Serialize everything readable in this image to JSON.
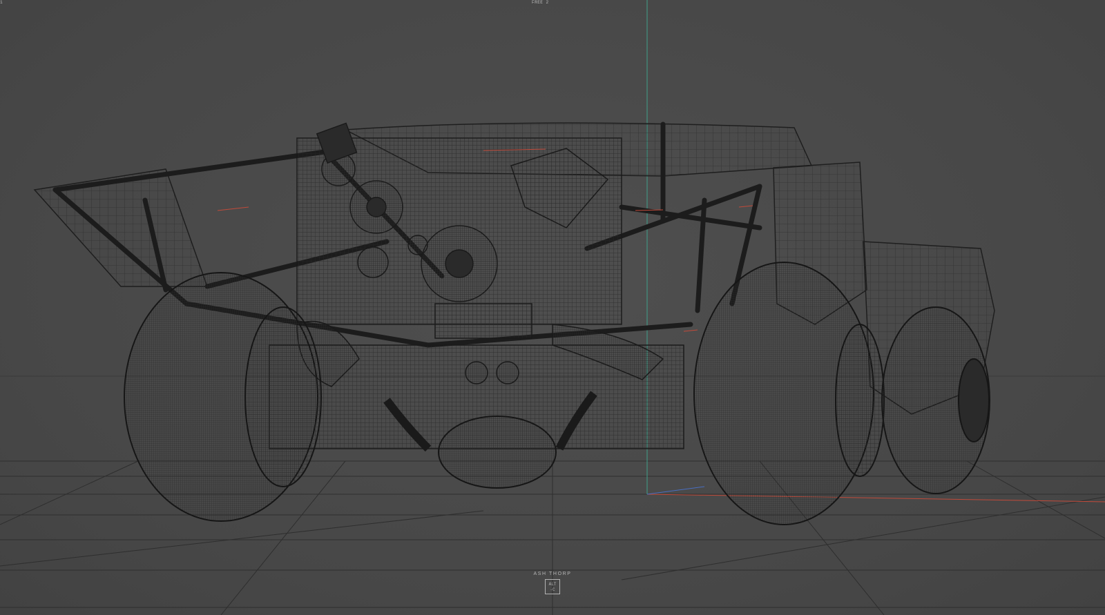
{
  "viewport": {
    "camera_label": "FREE 2",
    "corner_mark": "1"
  },
  "watermark": {
    "name": "ASH THORP",
    "logo_line1": "ALT",
    "logo_line2": "-C"
  },
  "colors": {
    "background": "#4a4a4a",
    "wire": "#1f1f1f",
    "grid": "#2c2c2c",
    "axis_green": "#3fa08a",
    "axis_red": "#c24a3a",
    "axis_blue": "#4a6fc2"
  }
}
